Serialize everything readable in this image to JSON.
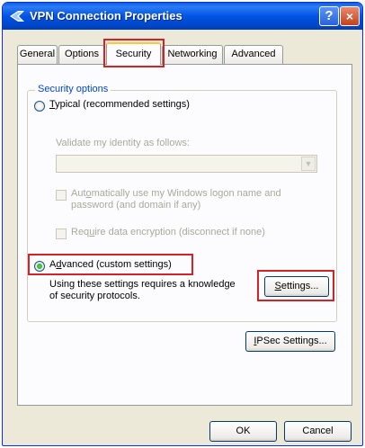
{
  "window": {
    "title": "VPN Connection Properties",
    "help_glyph": "?",
    "close_glyph": "×"
  },
  "tabs": [
    {
      "label": "General"
    },
    {
      "label": "Options"
    },
    {
      "label": "Security"
    },
    {
      "label": "Networking"
    },
    {
      "label": "Advanced"
    }
  ],
  "security": {
    "group_label": "Security options",
    "typical": {
      "label_key": "T",
      "label_rest": "ypical (recommended settings)",
      "checked": false
    },
    "validate_label": "Validate my identity as follows:",
    "validate_value": "",
    "auto_logon": {
      "label_pre": "Aut",
      "label_key": "o",
      "label_rest": "matically use my Windows logon name and",
      "line2": "password (and domain if any)",
      "checked": false
    },
    "require_encryption": {
      "label_pre": "Req",
      "label_key": "u",
      "label_rest": "ire data encryption (disconnect if none)",
      "checked": false
    },
    "advanced": {
      "label_pre": "A",
      "label_key": "d",
      "label_rest": "vanced (custom settings)",
      "checked": true
    },
    "advanced_desc_line1": "Using these settings requires a knowledge",
    "advanced_desc_line2": "of security protocols.",
    "settings_button": {
      "key": "S",
      "rest": "ettings..."
    },
    "ipsec_button": {
      "key": "I",
      "rest": "PSec Settings..."
    }
  },
  "footer": {
    "ok_label": "OK",
    "cancel_label": "Cancel"
  },
  "colors": {
    "highlight": "#d2232a",
    "title_bar": "#0054e3",
    "group_label": "#0046d5"
  }
}
